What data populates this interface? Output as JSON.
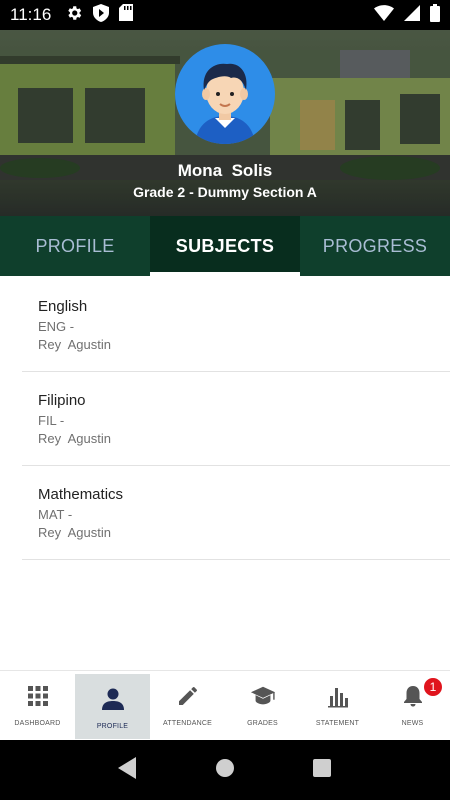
{
  "status_bar": {
    "time": "11:16",
    "left_icons": [
      "gear-icon",
      "play-protect-icon",
      "sd-card-icon"
    ],
    "right_icons": [
      "wifi-icon",
      "signal-icon",
      "battery-icon"
    ]
  },
  "student": {
    "name": "Mona  Solis",
    "section": "Grade 2 - Dummy Section A"
  },
  "tabs": [
    {
      "label": "PROFILE",
      "active": false
    },
    {
      "label": "SUBJECTS",
      "active": true
    },
    {
      "label": "PROGRESS",
      "active": false
    }
  ],
  "subjects": [
    {
      "title": "English",
      "code": "ENG -",
      "teacher": "Rey  Agustin"
    },
    {
      "title": "Filipino",
      "code": "FIL -",
      "teacher": "Rey  Agustin"
    },
    {
      "title": "Mathematics",
      "code": "MAT -",
      "teacher": "Rey  Agustin"
    }
  ],
  "bottom_nav": [
    {
      "label": "DASHBOARD",
      "icon": "grid-icon",
      "active": false
    },
    {
      "label": "PROFILE",
      "icon": "person-icon",
      "active": true
    },
    {
      "label": "ATTENDANCE",
      "icon": "pencil-icon",
      "active": false
    },
    {
      "label": "GRADES",
      "icon": "graduation-cap-icon",
      "active": false
    },
    {
      "label": "STATEMENT",
      "icon": "bar-chart-icon",
      "active": false
    },
    {
      "label": "NEWS",
      "icon": "bell-icon",
      "active": false,
      "badge": "1"
    }
  ],
  "colors": {
    "tab_bar": "#0f3f2c",
    "tab_active": "#082d1e",
    "avatar_bg": "#2e8de8",
    "badge": "#e0141d",
    "nav_active_bg": "#d9dedf"
  }
}
